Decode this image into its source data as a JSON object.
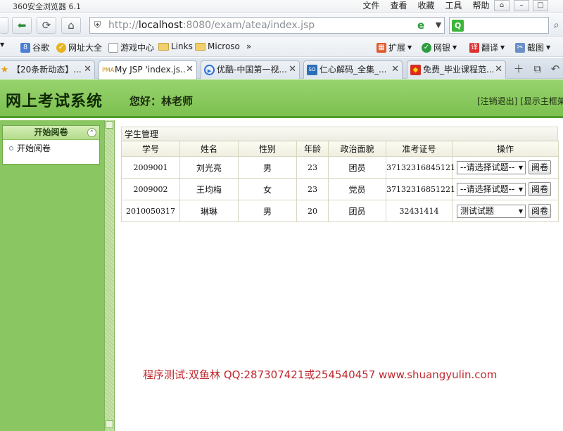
{
  "browser": {
    "title": "360安全浏览器 6.1",
    "menus": [
      "文件",
      "查看",
      "收藏",
      "工具",
      "帮助"
    ],
    "url_prefix": "http://",
    "url_host": "localhost",
    "url_rest": ":8080/exam/atea/index.jsp",
    "search_placeholder": "",
    "bookmarks": [
      "谷歌",
      "网址大全",
      "游戏中心",
      "Links",
      "Microso"
    ],
    "right_tools": [
      "扩展",
      "网银",
      "翻译",
      "截图"
    ],
    "tabs": [
      {
        "label": "【20条新动态】...",
        "active": false
      },
      {
        "label": "My JSP 'index.js...",
        "active": true
      },
      {
        "label": "优酷-中国第一视...",
        "active": false
      },
      {
        "label": "仁心解码_全集_...",
        "active": false
      },
      {
        "label": "免费_毕业课程范...",
        "active": false
      }
    ]
  },
  "header": {
    "title": "网上考试系统",
    "greeting": "您好：林老师",
    "logout": "[注销退出]",
    "show_frame": "[显示主框架"
  },
  "sidebar": {
    "panel_title": "开始阅卷",
    "items": [
      "开始阅卷"
    ]
  },
  "main": {
    "panel_title": "学生管理",
    "columns": [
      "学号",
      "姓名",
      "性别",
      "年龄",
      "政治面貌",
      "准考证号",
      "操作"
    ],
    "rows": [
      {
        "id": "2009001",
        "name": "刘光亮",
        "gender": "男",
        "age": "23",
        "political": "团员",
        "ticket": "37132316845121",
        "select": "--请选择试题--",
        "button": "阅卷"
      },
      {
        "id": "2009002",
        "name": "王均梅",
        "gender": "女",
        "age": "23",
        "political": "党员",
        "ticket": "37132316851221",
        "select": "--请选择试题--",
        "button": "阅卷"
      },
      {
        "id": "2010050317",
        "name": "琳琳",
        "gender": "男",
        "age": "20",
        "political": "团员",
        "ticket": "32431414",
        "select": "测试试题",
        "button": "阅卷"
      }
    ]
  },
  "footer_note": "程序测试:双鱼林 QQ:287307421或254540457 www.shuangyulin.com"
}
